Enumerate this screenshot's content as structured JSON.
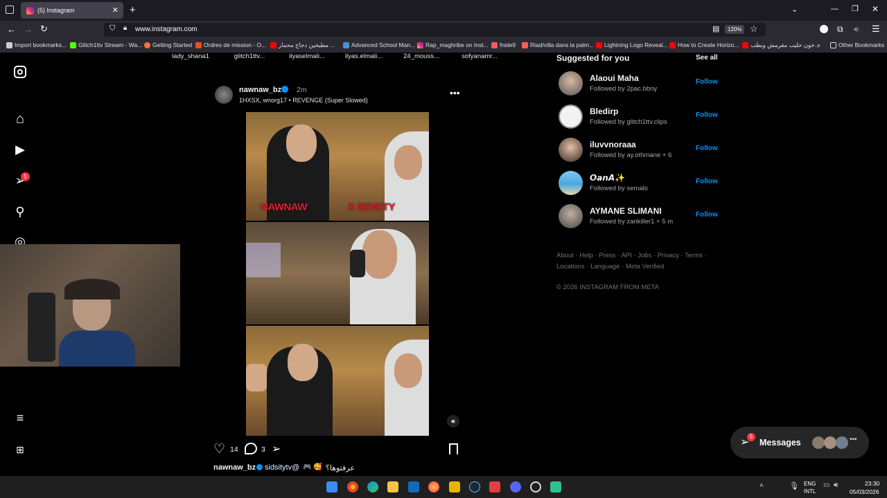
{
  "browser": {
    "tab_title": "(5) Instagram",
    "url": "www.instagram.com",
    "zoom": "120%",
    "bookmarks": [
      "Import bookmarks...",
      "Glitch1ttv Stream - Wa...",
      "Getting Started",
      "Ordres de mission - O...",
      "مطبخين دجاج محمار ...",
      "Advanced School Man...",
      "Rap_maghribe on Inst...",
      "fnide9",
      "Riad/villa dans la palm...",
      "Lightning Logo Reveal...",
      "How to Create Horizo...",
      "خون حلیب مقرمش وبطب...",
      "Other Bookmarks"
    ]
  },
  "stories": [
    "lady_shana1",
    "glitch1ttv...",
    "ilyaselmali...",
    "ilyas.elmali...",
    "24_mouss...",
    "sofyanamr..."
  ],
  "sidebar": {
    "notification_count": "5"
  },
  "post": {
    "username": "nawnaw_bz",
    "time": "2m",
    "audio": "1HXSX, wnorg17 • REVENGE (Super Slowed)",
    "overlay_text": "NAWNAW",
    "overlay_text2": "X SIDSITY",
    "likes": "14",
    "comments": "3",
    "caption_user": "nawnaw_bz",
    "caption_mention": "sidsitytv@",
    "caption_text": "عرفتوها؟"
  },
  "suggested": {
    "title": "Suggested for you",
    "see_all": "See all",
    "follow_label": "Follow",
    "users": [
      {
        "name": "Alaoui Maha",
        "sub": "Followed by 2pac.bbny"
      },
      {
        "name": "Bledirp",
        "sub": "Followed by glitch1ttv.clips"
      },
      {
        "name": "iluvvnoraaa",
        "sub": "Followed by ay.othmane + 6"
      },
      {
        "name": "𝙊𝙖𝙣𝘼✨",
        "sub": "Followed by semalo"
      },
      {
        "name": "AYMANE SLIMANI",
        "sub": "Followed by zankiller1 + 5 m"
      }
    ]
  },
  "footer": {
    "links1": "About · Help · Press · API · Jobs · Privacy · Terms ·",
    "links2": "Locations · Language · Meta Verified",
    "copyright": "© 2026 INSTAGRAM FROM META"
  },
  "messages": {
    "label": "Messages",
    "badge": "5"
  },
  "taskbar": {
    "lang1": "ENG",
    "lang2": "INTL",
    "time": "23:30",
    "date": "05/03/2026"
  }
}
